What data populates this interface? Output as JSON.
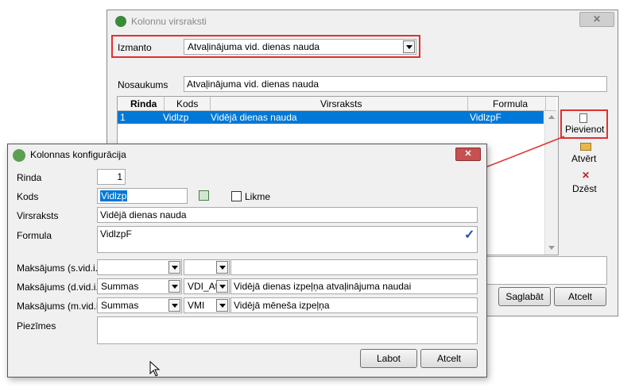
{
  "back_window": {
    "title": "Kolonnu virsraksti",
    "izmanto_label": "Izmanto",
    "izmanto_value": "Atvaļinājuma vid. dienas nauda",
    "nosaukums_label": "Nosaukums",
    "nosaukums_value": "Atvaļinājuma vid. dienas nauda",
    "table": {
      "headers": [
        "Rinda",
        "Kods",
        "Virsraksts",
        "Formula"
      ],
      "rows": [
        [
          "1",
          "Vidlzp",
          "Vidējā dienas nauda",
          "VidlzpF"
        ]
      ]
    },
    "side_buttons": {
      "pievienot": "Pievienot",
      "atvert": "Atvērt",
      "dzest": "Dzēst"
    },
    "saglabat": "Saglabāt",
    "atcelt": "Atcelt"
  },
  "dialog": {
    "title": "Kolonnas konfigurācija",
    "rinda_label": "Rinda",
    "rinda_value": "1",
    "kods_label": "Kods",
    "kods_value": "Vidlzp",
    "likme_label": "Likme",
    "virsraksts_label": "Virsraksts",
    "virsraksts_value": "Vidējā dienas nauda",
    "formula_label": "Formula",
    "formula_value": "VidlzpF",
    "maks_s_label": "Maksājums (s.vid.i.)",
    "maks_d_label": "Maksājums (d.vid.i.)",
    "maks_d_combo1": "Summas",
    "maks_d_combo2": "VDI_At",
    "maks_d_desc": "Vidējā dienas izpeļņa atvaļinājuma naudai",
    "maks_m_label": "Maksājums (m.vid.i.)",
    "maks_m_combo1": "Summas",
    "maks_m_combo2": "VMI",
    "maks_m_desc": "Vidējā mēneša izpeļņa",
    "piezimes_label": "Piezīmes",
    "labot": "Labot",
    "atcelt": "Atcelt"
  },
  "colors": {
    "selection": "#0078d7",
    "highlight_border": "#e03030",
    "close_red": "#c75050"
  }
}
